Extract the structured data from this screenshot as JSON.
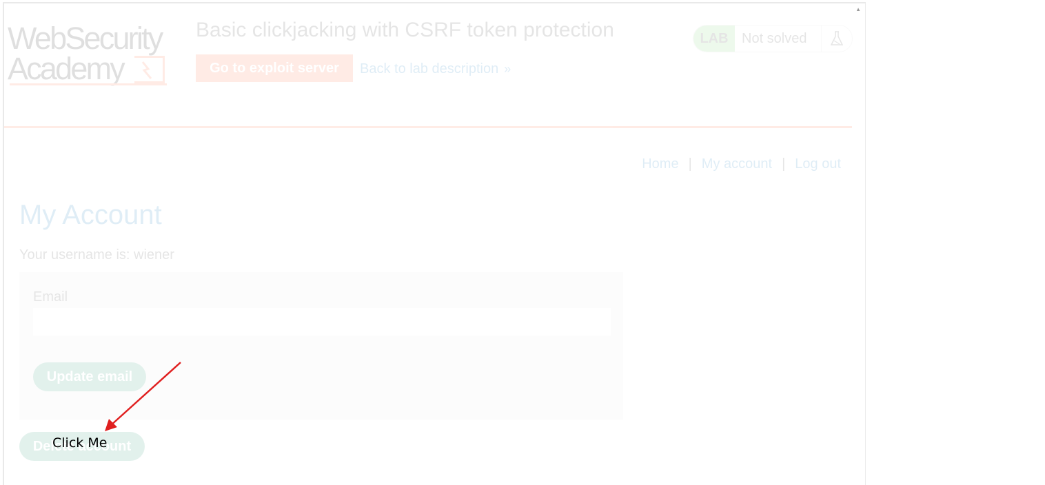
{
  "iframe": {
    "logo": {
      "line1": "WebSecurity",
      "line2": "Academy"
    },
    "lab_title": "Basic clickjacking with CSRF token protection",
    "exploit_button": "Go to exploit server",
    "back_link": "Back to lab description",
    "lab_status": {
      "badge": "LAB",
      "status": "Not solved"
    },
    "nav": {
      "home": "Home",
      "separator": "|",
      "my_account": "My account",
      "logout": "Log out"
    },
    "page_title": "My Account",
    "username_text": "Your username is: wiener",
    "email_form": {
      "label": "Email",
      "value": "",
      "update_button": "Update email"
    },
    "delete_button": "Delete account"
  },
  "decoy": {
    "text": "Click Me"
  },
  "colors": {
    "accent_orange": "#ff6633",
    "link_blue": "#0071bc",
    "button_green": "#1b8f6e",
    "lab_green": "#70d16d",
    "arrow_red": "#e02020"
  },
  "icons": {
    "flask": "flask-icon",
    "chevrons": "double-chevron-right-icon",
    "arrow": "red-arrow-annotation"
  }
}
